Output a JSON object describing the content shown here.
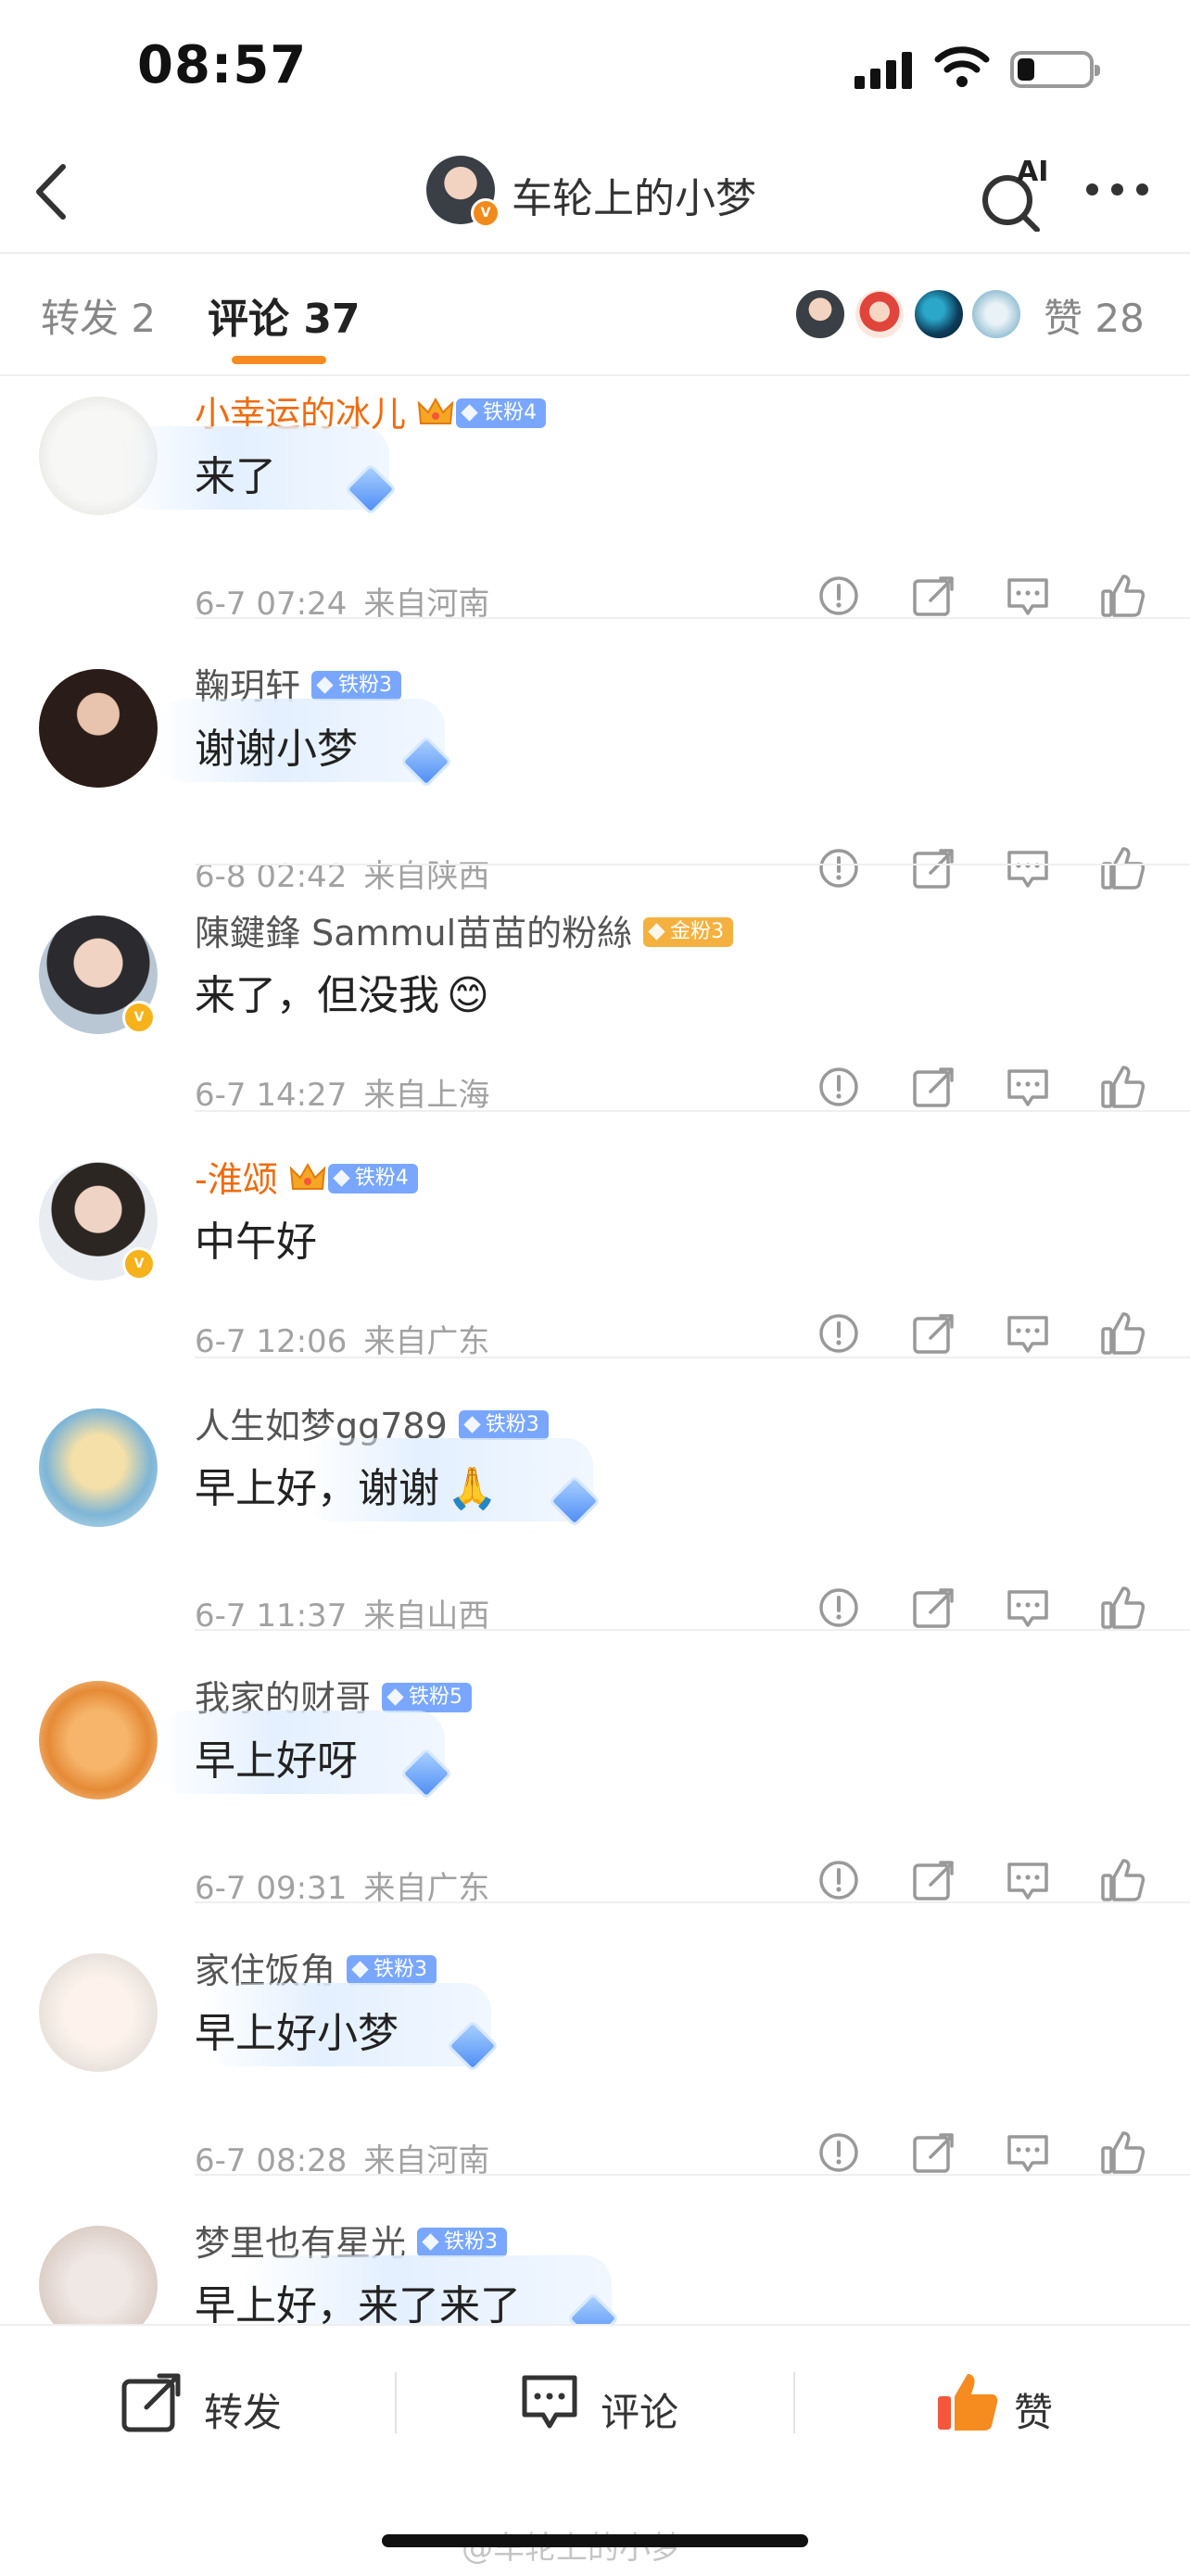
{
  "status_bar": {
    "time": "08:57"
  },
  "nav": {
    "title": "车轮上的小梦",
    "ai_label": "AI"
  },
  "tabs": {
    "repost": "转发 2",
    "comments": "评论 37",
    "likes": "赞 28"
  },
  "colors": {
    "accent_orange": "#f68b1f",
    "vip_name": "#f06b0f",
    "fan_badge_blue": "#79a7ff",
    "fan_badge_gold": "#f4b13f",
    "like_active": "#f4573a"
  },
  "comments": [
    {
      "name": "小幸运的冰儿",
      "badge": "铁粉4",
      "text": "来了",
      "time": "6-7 07:24",
      "location": "来自河南"
    },
    {
      "name": "鞠玥轩",
      "badge": "铁粉3",
      "text": "谢谢小梦",
      "time": "6-8 02:42",
      "location": "来自陕西"
    },
    {
      "name": "陳鍵鋒 Sammul苗苗的粉絲",
      "badge": "金粉3",
      "text": "来了，但没我",
      "time": "6-7 14:27",
      "location": "来自上海"
    },
    {
      "name": "-淮颂",
      "badge": "铁粉4",
      "text": "中午好",
      "time": "6-7 12:06",
      "location": "来自广东"
    },
    {
      "name": "人生如梦gg789",
      "badge": "铁粉3",
      "text": "早上好，谢谢",
      "time": "6-7 11:37",
      "location": "来自山西"
    },
    {
      "name": "我家的财哥",
      "badge": "铁粉5",
      "text": "早上好呀",
      "time": "6-7 09:31",
      "location": "来自广东"
    },
    {
      "name": "家住饭角",
      "badge": "铁粉3",
      "text": "早上好小梦",
      "time": "6-7 08:28",
      "location": "来自河南"
    },
    {
      "name": "梦里也有星光",
      "badge": "铁粉3",
      "text": "早上好，来了来了"
    }
  ],
  "icons": [
    "back-arrow-icon",
    "ai-search-icon",
    "more-icon",
    "report-icon",
    "share-icon",
    "reply-icon",
    "like-icon",
    "verified-icon",
    "crown-icon",
    "gem-icon",
    "emoji-icon",
    "pray-icon"
  ],
  "bottom_bar": {
    "repost": "转发",
    "comment": "评论",
    "like": "赞"
  },
  "watermark": "@车轮上的小梦"
}
